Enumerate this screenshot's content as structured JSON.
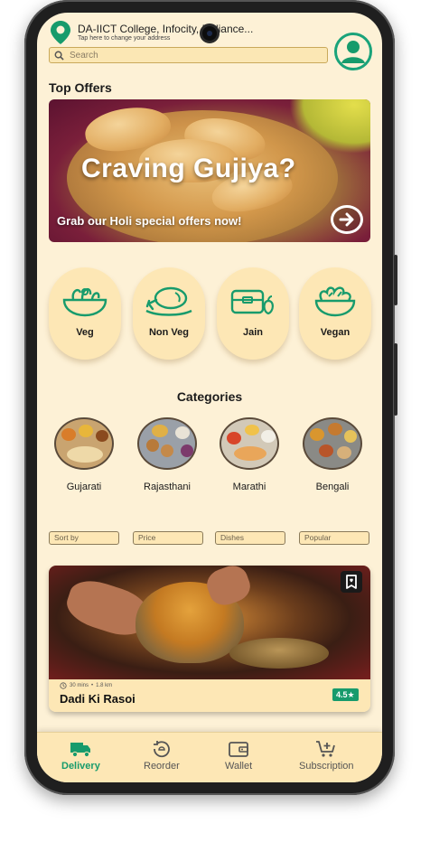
{
  "colors": {
    "accent": "#179b6c",
    "background": "#fdf1d6",
    "card": "#fde7b5"
  },
  "header": {
    "location_title": "DA-IICT College, Infocity, Reliance...",
    "location_subtitle": "Tap here to change your address",
    "location_icon": "location-pin-icon",
    "avatar_icon": "user-avatar-icon"
  },
  "search": {
    "placeholder": "Search",
    "icon": "search-icon"
  },
  "top_offers": {
    "title": "Top Offers",
    "banner_heading": "Craving Gujiya?",
    "banner_subtext": "Grab our Holi special offers now!",
    "arrow_icon": "arrow-right-circle-icon"
  },
  "diet_options": [
    {
      "label": "Veg",
      "icon": "salad-bowl-icon"
    },
    {
      "label": "Non Veg",
      "icon": "chicken-leg-icon"
    },
    {
      "label": "Jain",
      "icon": "lunchbox-apple-icon"
    },
    {
      "label": "Vegan",
      "icon": "vegan-bowl-icon"
    }
  ],
  "categories": {
    "title": "Categories",
    "items": [
      {
        "label": "Gujarati"
      },
      {
        "label": "Rajasthani"
      },
      {
        "label": "Marathi"
      },
      {
        "label": "Bengali"
      }
    ]
  },
  "filters": [
    "Sort by",
    "Price",
    "Dishes",
    "Popular"
  ],
  "restaurant": {
    "name": "Dadi Ki Rasoi",
    "time": "30 mins",
    "distance": "1.8 km",
    "separator": "•",
    "rating": "4.5★",
    "bookmark_icon": "bookmark-heart-icon"
  },
  "bottom_nav": [
    {
      "label": "Delivery",
      "icon": "delivery-truck-icon",
      "active": true
    },
    {
      "label": "Reorder",
      "icon": "reorder-icon",
      "active": false
    },
    {
      "label": "Wallet",
      "icon": "wallet-icon",
      "active": false
    },
    {
      "label": "Subscription",
      "icon": "cart-plus-icon",
      "active": false
    }
  ]
}
